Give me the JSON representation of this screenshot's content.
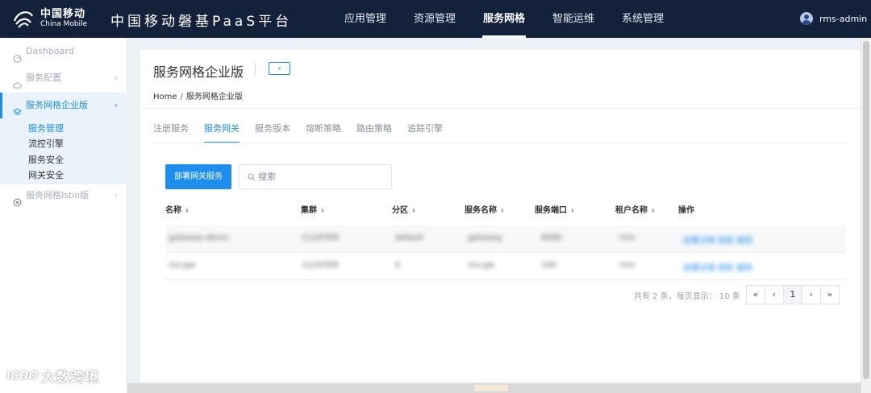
{
  "header": {
    "logo": {
      "cn": "中国移动",
      "en": "China Mobile"
    },
    "product_title": "中国移动磐基PaaS平台",
    "nav": [
      {
        "label": "应用管理",
        "active": false
      },
      {
        "label": "资源管理",
        "active": false
      },
      {
        "label": "服务网格",
        "active": true
      },
      {
        "label": "智能运维",
        "active": false
      },
      {
        "label": "系统管理",
        "active": false
      }
    ],
    "user": "rms-admin"
  },
  "sidebar": {
    "items": [
      {
        "label": "Dashboard",
        "icon": "dashboard-icon"
      },
      {
        "label": "服务配置",
        "icon": "cloud-icon"
      },
      {
        "label": "服务网格企业版",
        "icon": "layers-icon",
        "active": true
      },
      {
        "label": "服务网格Istio版",
        "icon": "target-icon"
      }
    ],
    "submenu": [
      {
        "label": "服务管理",
        "active": true
      },
      {
        "label": "流控引擎"
      },
      {
        "label": "服务安全"
      },
      {
        "label": "网关安全"
      }
    ]
  },
  "main": {
    "page_title": "服务网格企业版",
    "collapse_glyph": "‹",
    "breadcrumb": {
      "home": "Home",
      "sep": "/",
      "current": "服务网格企业版"
    },
    "tabs": [
      {
        "label": "注册服务"
      },
      {
        "label": "服务网关",
        "active": true
      },
      {
        "label": "服务版本"
      },
      {
        "label": "熔断策略"
      },
      {
        "label": "路由策略"
      },
      {
        "label": "追踪引擎"
      }
    ],
    "deploy_button": "部署网关服务",
    "search_placeholder": "搜索",
    "table": {
      "columns": [
        "名称",
        "集群",
        "分区",
        "服务名称",
        "服务端口",
        "租户名称",
        "操作"
      ],
      "sort_glyph": "⬍",
      "rows": [
        [
          "gateway-demo",
          "CLUSTER",
          "default",
          "gateway",
          "8080",
          "rms",
          "部署详情  更新  删除"
        ],
        [
          "ms-gw",
          "CLUSTER",
          "0",
          "ms-gw",
          "100",
          "rms",
          "部署详情  更新  删除"
        ]
      ]
    },
    "pagination": {
      "info": "共有 2 条，每页显示： 10 条",
      "first": "«",
      "prev": "‹",
      "current": "1",
      "next": "›",
      "last": "»"
    }
  },
  "watermark": {
    "mark": "ICOO",
    "text": "大数跨境"
  },
  "colors": {
    "header_bg": "#14213a",
    "accent": "#1f8fe6",
    "primary_button": "#1b8ef0"
  }
}
